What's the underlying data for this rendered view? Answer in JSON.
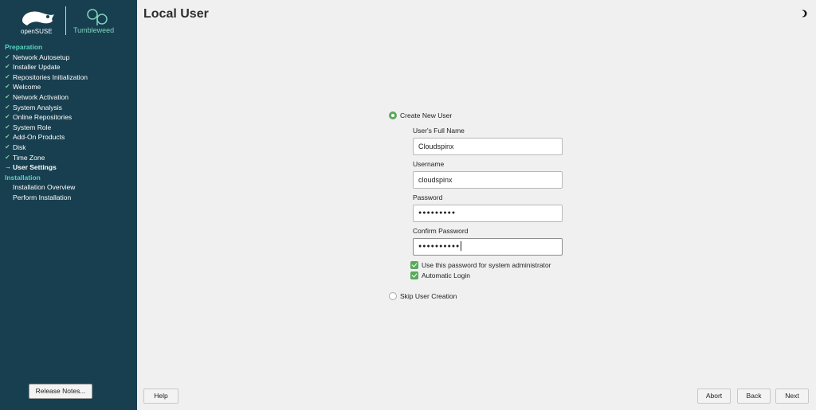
{
  "brand": {
    "opensuse_logo": "openSUSE",
    "tumbleweed": "Tumbleweed"
  },
  "sidebar": {
    "sections": [
      {
        "label": "Preparation",
        "steps": [
          {
            "label": "Network Autosetup",
            "state": "done"
          },
          {
            "label": "Installer Update",
            "state": "done"
          },
          {
            "label": "Repositories Initialization",
            "state": "done"
          },
          {
            "label": "Welcome",
            "state": "done"
          },
          {
            "label": "Network Activation",
            "state": "done"
          },
          {
            "label": "System Analysis",
            "state": "done"
          },
          {
            "label": "Online Repositories",
            "state": "done"
          },
          {
            "label": "System Role",
            "state": "done"
          },
          {
            "label": "Add-On Products",
            "state": "done"
          },
          {
            "label": "Disk",
            "state": "done"
          },
          {
            "label": "Time Zone",
            "state": "done"
          },
          {
            "label": "User Settings",
            "state": "current"
          }
        ]
      },
      {
        "label": "Installation",
        "steps": [
          {
            "label": "Installation Overview",
            "state": "pending"
          },
          {
            "label": "Perform Installation",
            "state": "pending"
          }
        ]
      }
    ],
    "release_notes_label": "Release Notes..."
  },
  "page": {
    "title": "Local User",
    "create_new_user_label": "Create New User",
    "full_name_label": "User's Full Name",
    "full_name_value": "Cloudspinx",
    "username_label": "Username",
    "username_value": "cloudspinx",
    "password_label": "Password",
    "password_mask": "●●●●●●●●●",
    "confirm_password_label": "Confirm Password",
    "confirm_password_mask": "●●●●●●●●●●",
    "use_for_admin_label": "Use this password for system administrator",
    "use_for_admin_checked": true,
    "automatic_login_label": "Automatic Login",
    "automatic_login_checked": true,
    "skip_user_creation_label": "Skip User Creation",
    "selected_option": "create"
  },
  "footer": {
    "help": "Help",
    "abort": "Abort",
    "back": "Back",
    "next": "Next"
  },
  "colors": {
    "sidebar_bg": "#173f4f",
    "section_heading": "#59d2c0",
    "accent_green": "#5aa95c",
    "page_bg": "#f0f0f0"
  },
  "icons": {
    "check": "check-icon",
    "current": "arrow-right-icon",
    "mode": "half-moon-icon"
  }
}
